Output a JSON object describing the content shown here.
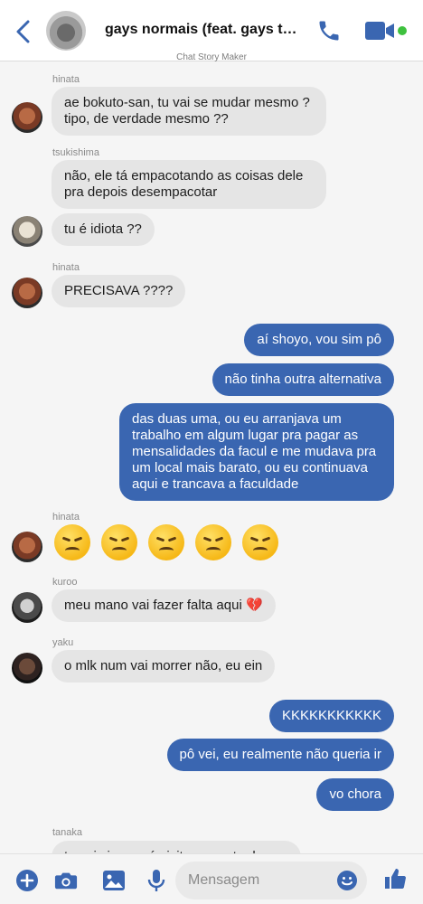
{
  "header": {
    "title": "gays normais (feat. gays tóxi...",
    "watermark": "Chat Story Maker"
  },
  "colors": {
    "accent": "#3a66b1",
    "online": "#3ec13e",
    "incoming_bubble": "#e5e5e5"
  },
  "messages": [
    {
      "sender": "hinata",
      "text": "ae bokuto-san, tu vai se mudar mesmo ? tipo, de verdade mesmo ??"
    },
    {
      "sender": "tsukishima",
      "text": "não, ele tá empacotando as coisas dele pra depois desempacotar"
    },
    {
      "sender": "tsukishima",
      "text": "tu é idiota ??"
    },
    {
      "sender": "hinata",
      "text": "PRECISAVA ????"
    },
    {
      "sender": "me",
      "text": "aí shoyo, vou sim pô"
    },
    {
      "sender": "me",
      "text": "não tinha outra alternativa"
    },
    {
      "sender": "me",
      "text": "das duas uma, ou eu arranjava um trabalho em algum lugar pra pagar as mensalidades da facul e me mudava pra um local mais barato, ou eu continuava aqui e trancava a faculdade"
    },
    {
      "sender": "hinata",
      "text": "😞😞😞😞😞",
      "emoji_count": 5
    },
    {
      "sender": "kuroo",
      "text": "meu mano vai fazer falta aqui 💔"
    },
    {
      "sender": "yaku",
      "text": "o mlk num vai morrer não, eu ein"
    },
    {
      "sender": "me",
      "text": "KKKKKKKKKKK"
    },
    {
      "sender": "me",
      "text": "pô vei, eu realmente não queria ir"
    },
    {
      "sender": "me",
      "text": "vo chora"
    },
    {
      "sender": "tanaka",
      "text": "tu vai vir pra cá visitar a gente de vez"
    }
  ],
  "composer": {
    "placeholder": "Mensagem"
  }
}
